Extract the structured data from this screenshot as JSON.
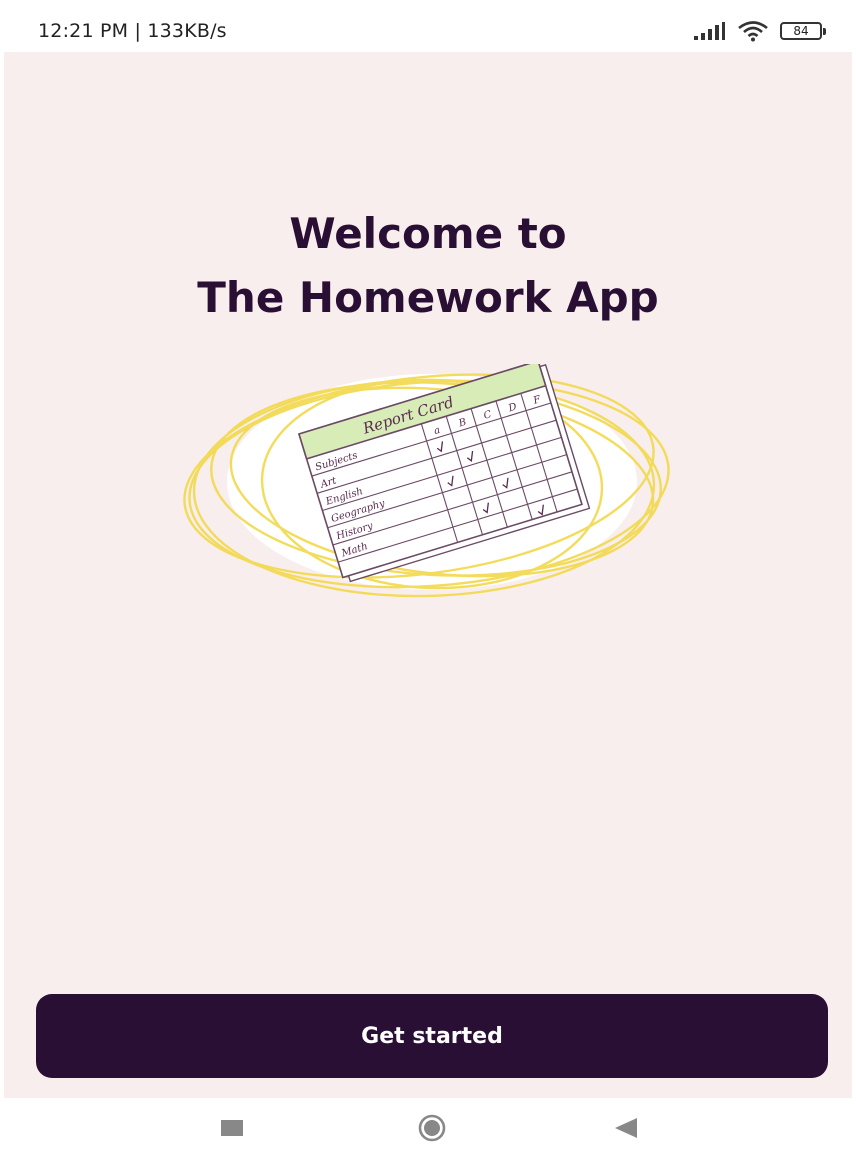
{
  "status_bar": {
    "time_speed": "12:21 PM | 133KB/s",
    "battery_level": "84",
    "icons": [
      "signal-icon",
      "wifi-icon",
      "battery-icon"
    ]
  },
  "welcome": {
    "line1": "Welcome to",
    "line2": "The Homework App"
  },
  "illustration": {
    "card_title": "Report Card",
    "icon": "report-card-illustration",
    "grade_columns": [
      "a",
      "B",
      "C",
      "D",
      "F"
    ],
    "subjects": [
      "Subjects",
      "Art",
      "English",
      "Geography",
      "History",
      "Math"
    ]
  },
  "cta": {
    "label": "Get started"
  },
  "nav_bar": {
    "icons": [
      "recent-apps-icon",
      "home-icon",
      "back-icon"
    ]
  },
  "colors": {
    "background": "#f9eeee",
    "primary": "#2a0f35",
    "accent_scribble": "#f2d94a",
    "card_header": "#d7ecb6"
  }
}
